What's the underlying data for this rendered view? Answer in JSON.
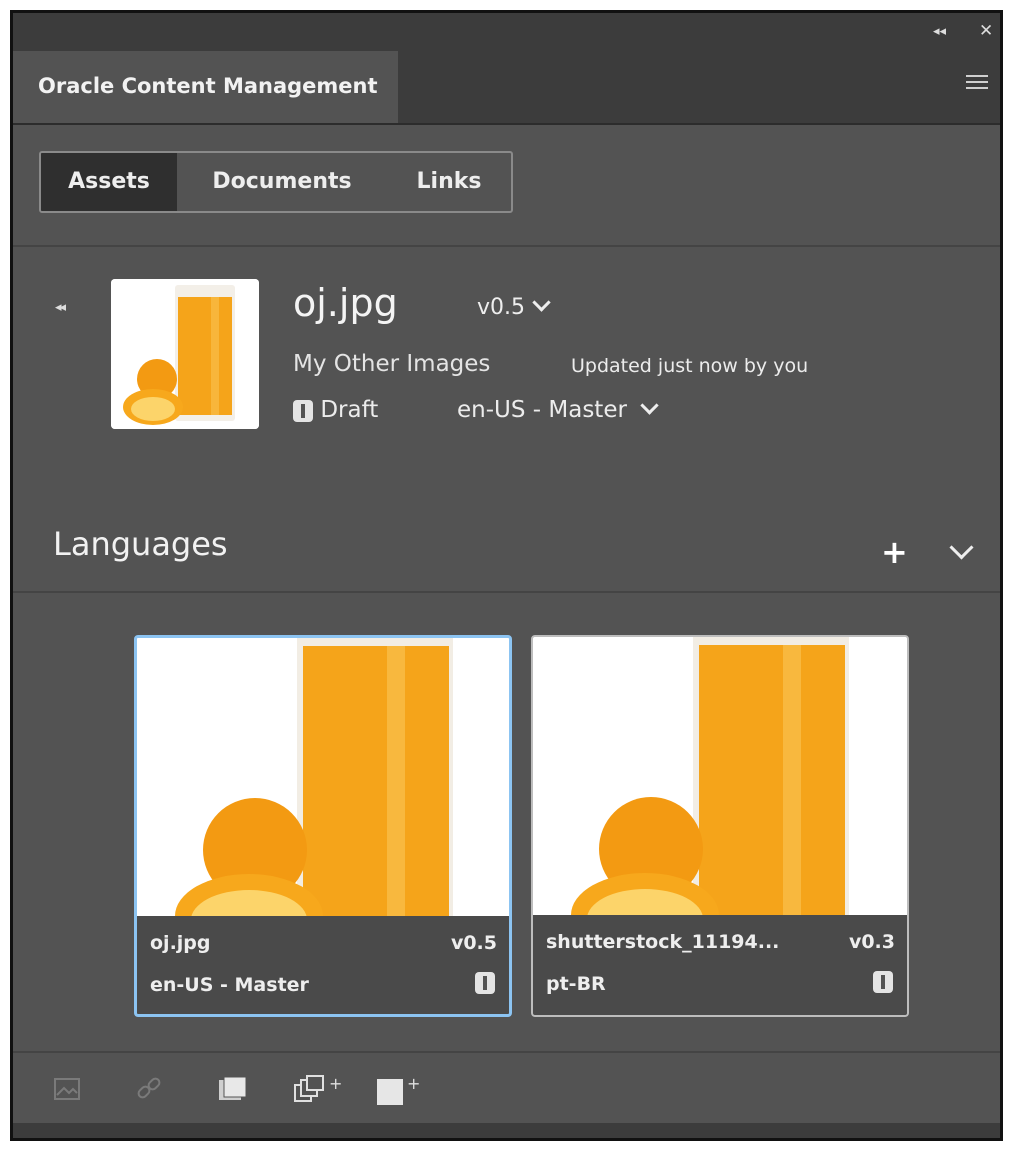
{
  "panel": {
    "title": "Oracle Content Management",
    "collapse_icon": "double-chevron-left-icon",
    "close_icon": "close-icon",
    "menu_icon": "hamburger-menu-icon"
  },
  "tabs": [
    "Assets",
    "Documents",
    "Links"
  ],
  "active_tab": "Assets",
  "asset": {
    "name": "oj.jpg",
    "version": "v0.5",
    "folder": "My Other Images",
    "updated": "Updated just now by you",
    "status": "Draft",
    "locale": "en-US - Master"
  },
  "languages": {
    "title": "Languages",
    "add_label": "+",
    "cards": [
      {
        "name": "oj.jpg",
        "version": "v0.5",
        "locale": "en-US - Master",
        "selected": true
      },
      {
        "name": "shutterstock_11194...",
        "version": "v0.3",
        "locale": "pt-BR",
        "selected": false
      }
    ]
  },
  "footer_icons": [
    "image-icon",
    "link-icon",
    "stack-icon",
    "duplicate-plus-icon",
    "frame-plus-icon"
  ],
  "colors": {
    "panel_bg": "#535353",
    "header_bg": "#3c3c3c",
    "selection": "#8cc4f2",
    "juice": "#f5a41a"
  }
}
